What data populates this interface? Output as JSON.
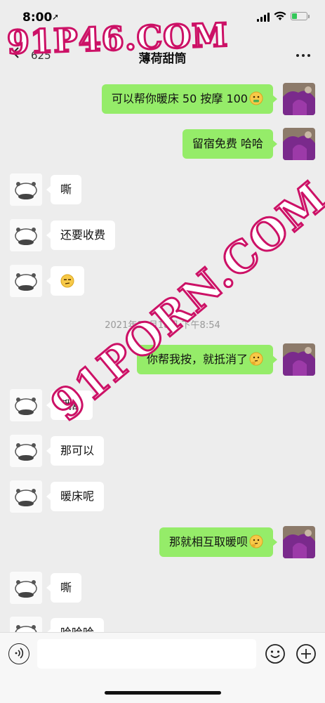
{
  "status_bar": {
    "time": "8:00"
  },
  "nav": {
    "back_count": "625",
    "title": "薄荷甜筒"
  },
  "watermarks": [
    "91P46.COM",
    "91PORN.COM"
  ],
  "messages": [
    {
      "from": "me",
      "text": "可以帮你暖床 50  按摩 100",
      "emoji": "money-mouth-emoji"
    },
    {
      "from": "me",
      "text": "留宿免费  哈哈",
      "emoji": ""
    },
    {
      "from": "other",
      "text": "嘶",
      "emoji": ""
    },
    {
      "from": "other",
      "text": "还要收费",
      "emoji": ""
    },
    {
      "from": "other",
      "text": "",
      "emoji": "unamused-emoji"
    },
    {
      "from": "me",
      "text": "你帮我按，就抵消了",
      "emoji": "thinking-emoji"
    },
    {
      "from": "other",
      "text": "哦豁",
      "emoji": ""
    },
    {
      "from": "other",
      "text": "那可以",
      "emoji": ""
    },
    {
      "from": "other",
      "text": "暖床呢",
      "emoji": ""
    },
    {
      "from": "me",
      "text": "那就相互取暖呗",
      "emoji": "thinking-emoji"
    },
    {
      "from": "other",
      "text": "嘶",
      "emoji": ""
    },
    {
      "from": "other",
      "text": "哈哈哈",
      "emoji": ""
    }
  ],
  "timestamp": "2021年10月18日 下午8:54",
  "input": {
    "value": "",
    "placeholder": ""
  },
  "colors": {
    "my_bubble": "#95ec69",
    "other_bubble": "#ffffff",
    "background": "#ededed",
    "watermark_stroke": "#cc1166"
  }
}
